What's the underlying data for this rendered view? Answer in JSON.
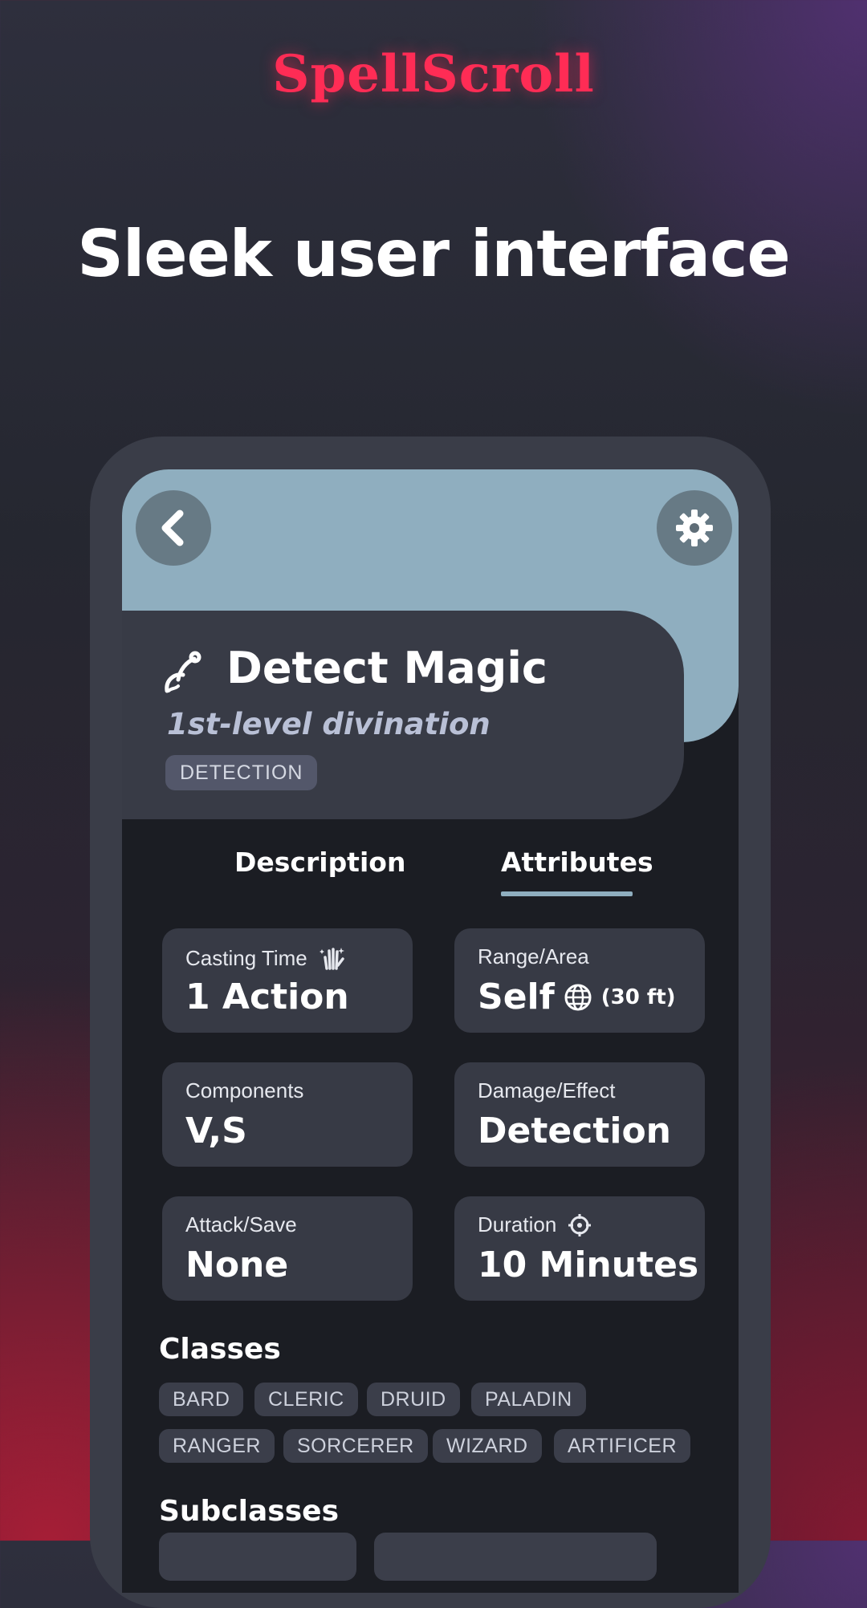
{
  "brand": {
    "logo_text": "SpellScroll"
  },
  "headline": "Sleek user interface",
  "spell": {
    "name": "Detect Magic",
    "level_school": "1st-level divination",
    "tag": "DETECTION"
  },
  "tabs": [
    {
      "label": "Description",
      "active": false
    },
    {
      "label": "Attributes",
      "active": true
    }
  ],
  "attributes": {
    "casting_time": {
      "label": "Casting Time",
      "value": "1 Action",
      "icon": "hand-sparkle-icon"
    },
    "range_area": {
      "label": "Range/Area",
      "value": "Self",
      "extra": "(30 ft)",
      "icon": "sphere-icon"
    },
    "components": {
      "label": "Components",
      "value": "V,S"
    },
    "damage_effect": {
      "label": "Damage/Effect",
      "value": "Detection"
    },
    "attack_save": {
      "label": "Attack/Save",
      "value": "None"
    },
    "duration": {
      "label": "Duration",
      "value": "10 Minutes",
      "icon": "concentration-icon"
    }
  },
  "classes": {
    "title": "Classes",
    "items": [
      "BARD",
      "CLERIC",
      "DRUID",
      "PALADIN",
      "RANGER",
      "SORCERER",
      "WIZARD",
      "ARTIFICER"
    ]
  },
  "subclasses": {
    "title": "Subclasses"
  },
  "colors": {
    "accent": "#8faebf",
    "brand": "#ff2c55",
    "card": "#373a45",
    "screen_bg": "#1b1d23"
  }
}
